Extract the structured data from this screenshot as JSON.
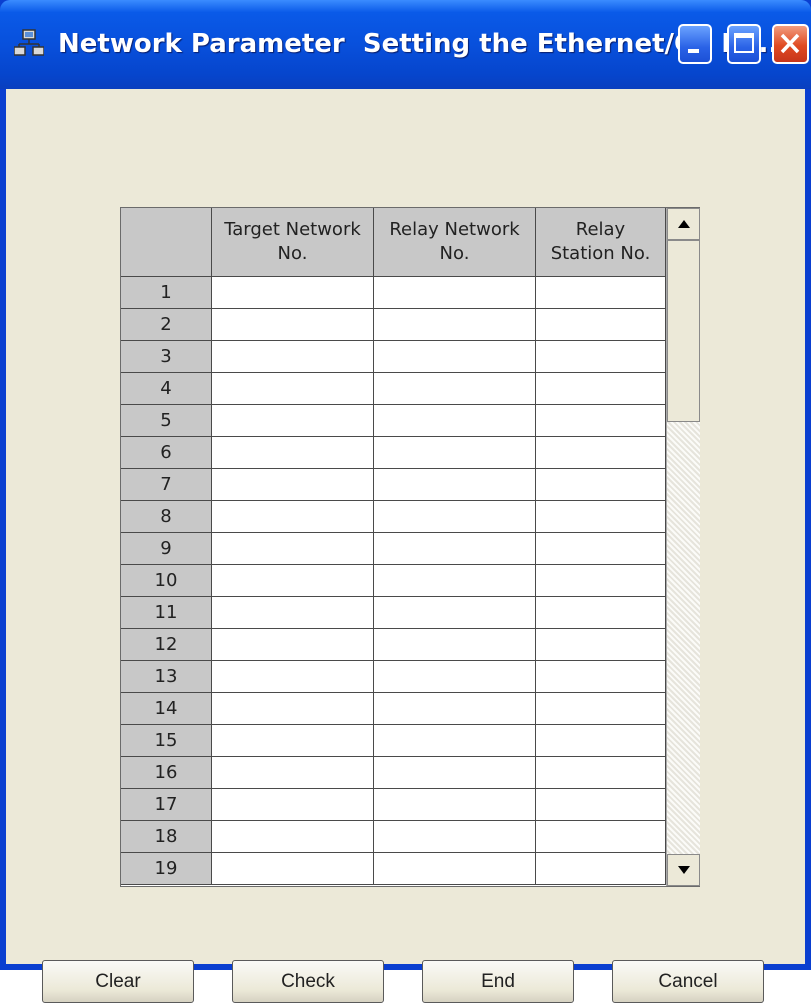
{
  "window": {
    "title": "Network Parameter  Setting the Ethernet/CC IE...",
    "controls": {
      "minimize": "minimize-icon",
      "maximize": "maximize-icon",
      "close": "close-icon"
    }
  },
  "table": {
    "headers": [
      "Target Network\nNo.",
      "Relay Network\nNo.",
      "Relay\nStation No."
    ],
    "rows": [
      "1",
      "2",
      "3",
      "4",
      "5",
      "6",
      "7",
      "8",
      "9",
      "10",
      "11",
      "12",
      "13",
      "14",
      "15",
      "16",
      "17",
      "18",
      "19"
    ]
  },
  "buttons": {
    "clear": "Clear",
    "check": "Check",
    "end": "End",
    "cancel": "Cancel"
  }
}
